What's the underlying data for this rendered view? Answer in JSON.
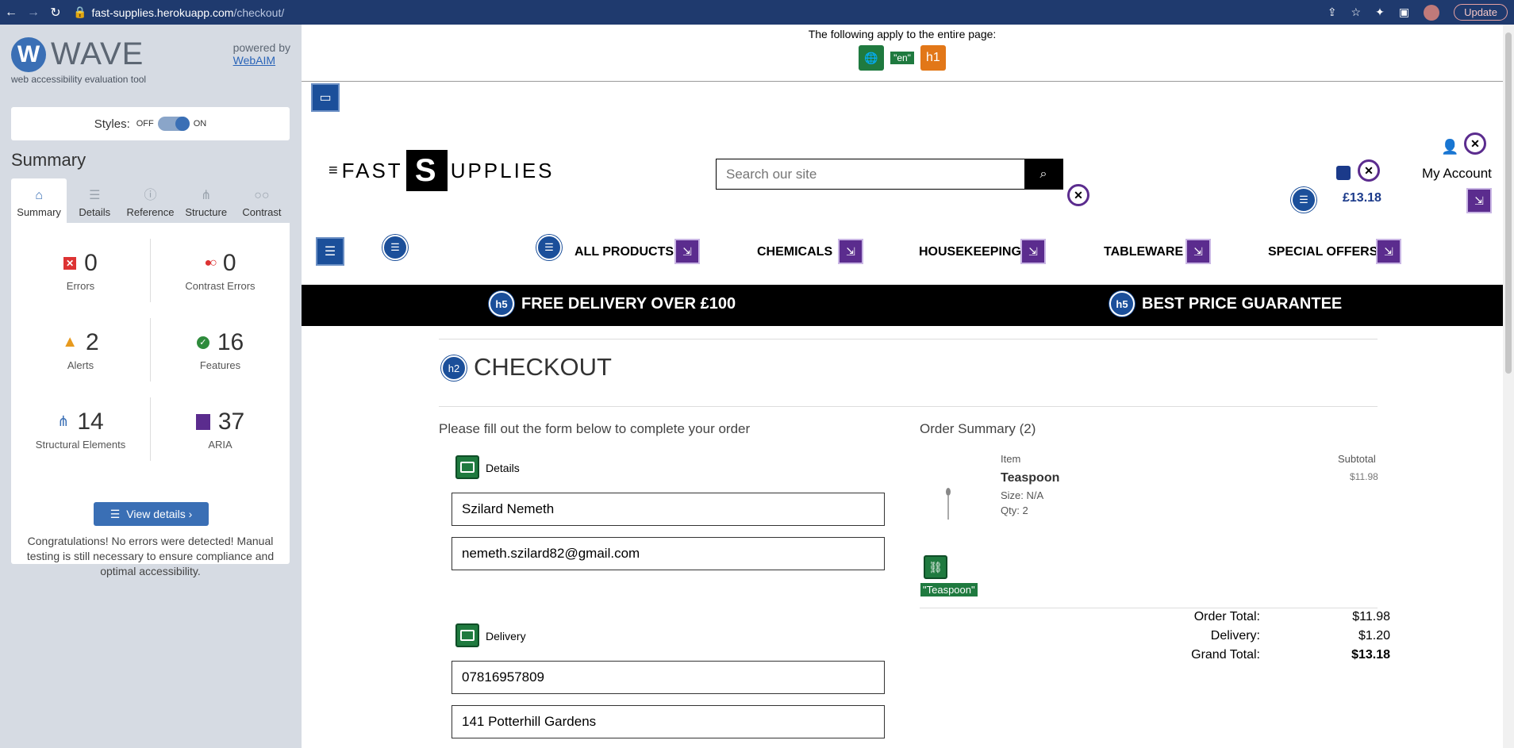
{
  "browser": {
    "url_host": "fast-supplies.herokuapp.com",
    "url_path": "/checkout/",
    "update_label": "Update"
  },
  "wave": {
    "logo_letter": "W",
    "name": "WAVE",
    "subtitle": "web accessibility evaluation tool",
    "powered_by": "powered by",
    "webaim": "WebAIM",
    "styles_label": "Styles:",
    "off": "OFF",
    "on": "ON",
    "summary_title": "Summary",
    "tabs": [
      "Summary",
      "Details",
      "Reference",
      "Structure",
      "Contrast"
    ],
    "stats": {
      "errors": {
        "value": "0",
        "label": "Errors"
      },
      "contrast": {
        "value": "0",
        "label": "Contrast Errors"
      },
      "alerts": {
        "value": "2",
        "label": "Alerts"
      },
      "features": {
        "value": "16",
        "label": "Features"
      },
      "structural": {
        "value": "14",
        "label": "Structural Elements"
      },
      "aria": {
        "value": "37",
        "label": "ARIA"
      }
    },
    "view_details": "View details ›",
    "congrats": "Congratulations! No errors were detected! Manual testing is still necessary to ensure compliance and optimal accessibility."
  },
  "page": {
    "applies_text": "The following apply to the entire page:",
    "lang_tag": "\"en\"",
    "h1_badge": "h1",
    "logo_left": "FAST",
    "logo_s": "S",
    "logo_right": "UPPLIES",
    "search_placeholder": "Search our site",
    "cart_total": "£13.18",
    "my_account": "My Account",
    "nav": [
      "ALL PRODUCTS",
      "CHEMICALS",
      "HOUSEKEEPING",
      "TABLEWARE",
      "SPECIAL OFFERS"
    ],
    "banner_left": "FREE DELIVERY OVER £100",
    "banner_right": "BEST PRICE GUARANTEE",
    "h5_badge": "h5",
    "h2_badge": "h2",
    "checkout_title": "CHECKOUT",
    "form_intro": "Please fill out the form below to complete your order",
    "details_legend": "Details",
    "full_name": "Szilard Nemeth",
    "email": "nemeth.szilard82@gmail.com",
    "delivery_legend": "Delivery",
    "phone": "07816957809",
    "address": "141 Potterhill Gardens",
    "order_title": "Order Summary (2)",
    "col_item": "Item",
    "col_subtotal": "Subtotal",
    "item_name": "Teaspoon",
    "item_size": "Size: N/A",
    "item_qty": "Qty: 2",
    "item_price": "$11.98",
    "item_alt": "\"Teaspoon\"",
    "order_total_label": "Order Total:",
    "order_total": "$11.98",
    "delivery_label": "Delivery:",
    "delivery": "$1.20",
    "grand_total_label": "Grand Total:",
    "grand_total": "$13.18"
  }
}
